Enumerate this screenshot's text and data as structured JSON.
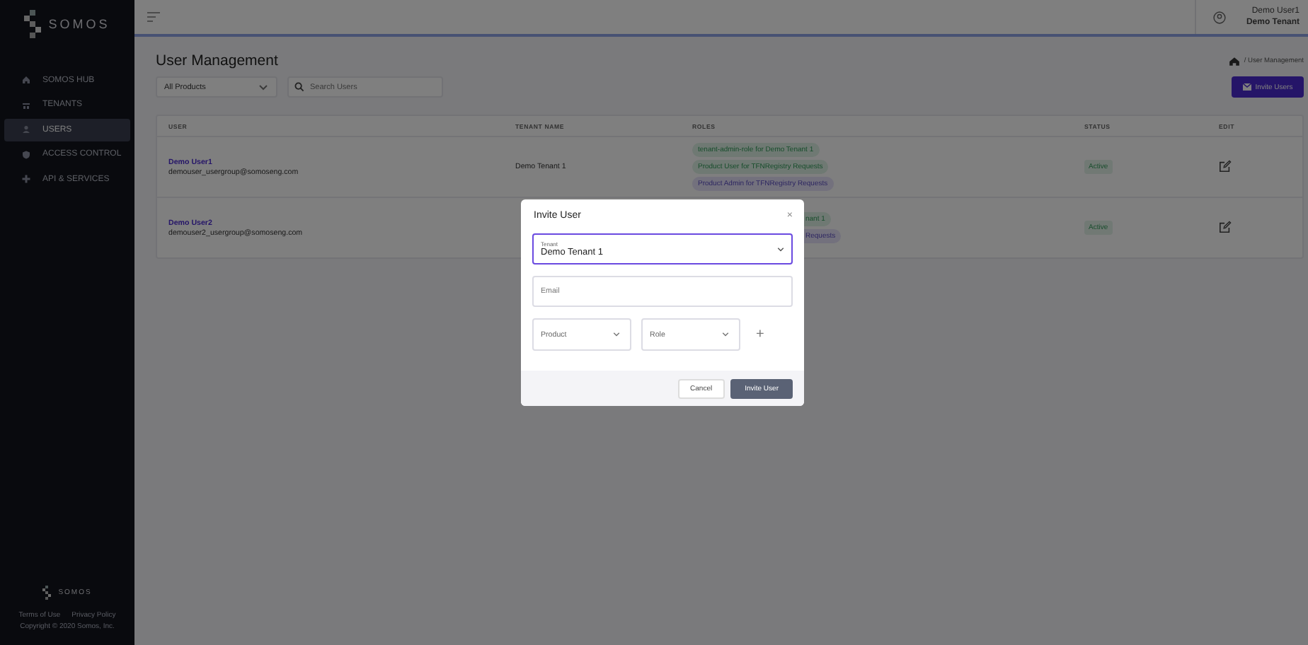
{
  "brand": {
    "name": "SOMOS"
  },
  "sidebar": {
    "items": [
      {
        "label": "SOMOS HUB",
        "selected": false
      },
      {
        "label": "TENANTS",
        "selected": false
      },
      {
        "label": "USERS",
        "selected": true
      },
      {
        "label": "ACCESS CONTROL",
        "selected": false
      },
      {
        "label": "API & SERVICES",
        "selected": false
      }
    ],
    "footer_brand": "SOMOS",
    "links": [
      "Terms of Use",
      "Privacy Policy"
    ],
    "copyright": "Copyright © 2020 Somos, Inc."
  },
  "topbar": {
    "user_name": "Demo User1",
    "tenant": "Demo Tenant"
  },
  "page": {
    "title": "User Management",
    "breadcrumb": "/ User Management",
    "invite_button": "Invite Users",
    "product_filter": "All Products",
    "search": {
      "placeholder": "Search Users"
    }
  },
  "table": {
    "columns": [
      "USER",
      "TENANT NAME",
      "ROLES",
      "STATUS",
      "EDIT"
    ],
    "rows": [
      {
        "name": "Demo User1",
        "email": "demouser_usergroup@somoseng.com",
        "tenant": "Demo Tenant 1",
        "status": "Active",
        "roles": [
          {
            "label": "tenant-admin-role for Demo Tenant 1",
            "kind": "user"
          },
          {
            "label": "Product User for TFNRegistry Requests",
            "kind": "user"
          },
          {
            "label": "Product Admin for TFNRegistry Requests",
            "kind": "admin"
          }
        ]
      },
      {
        "name": "Demo User2",
        "email": "demouser2_usergroup@somoseng.com",
        "covered": true,
        "status": "Active",
        "roles": [
          {
            "label": "nant 1",
            "kind": "user"
          },
          {
            "label": "Requests",
            "kind": "admin"
          }
        ]
      }
    ]
  },
  "modal": {
    "title": "Invite User",
    "close": "×",
    "tenant": {
      "label": "Tenant",
      "value": "Demo Tenant 1"
    },
    "email": {
      "placeholder": "Email"
    },
    "product": {
      "placeholder": "Product"
    },
    "role": {
      "placeholder": "Role"
    },
    "add": "+",
    "buttons": [
      "Cancel",
      "Invite User"
    ]
  }
}
